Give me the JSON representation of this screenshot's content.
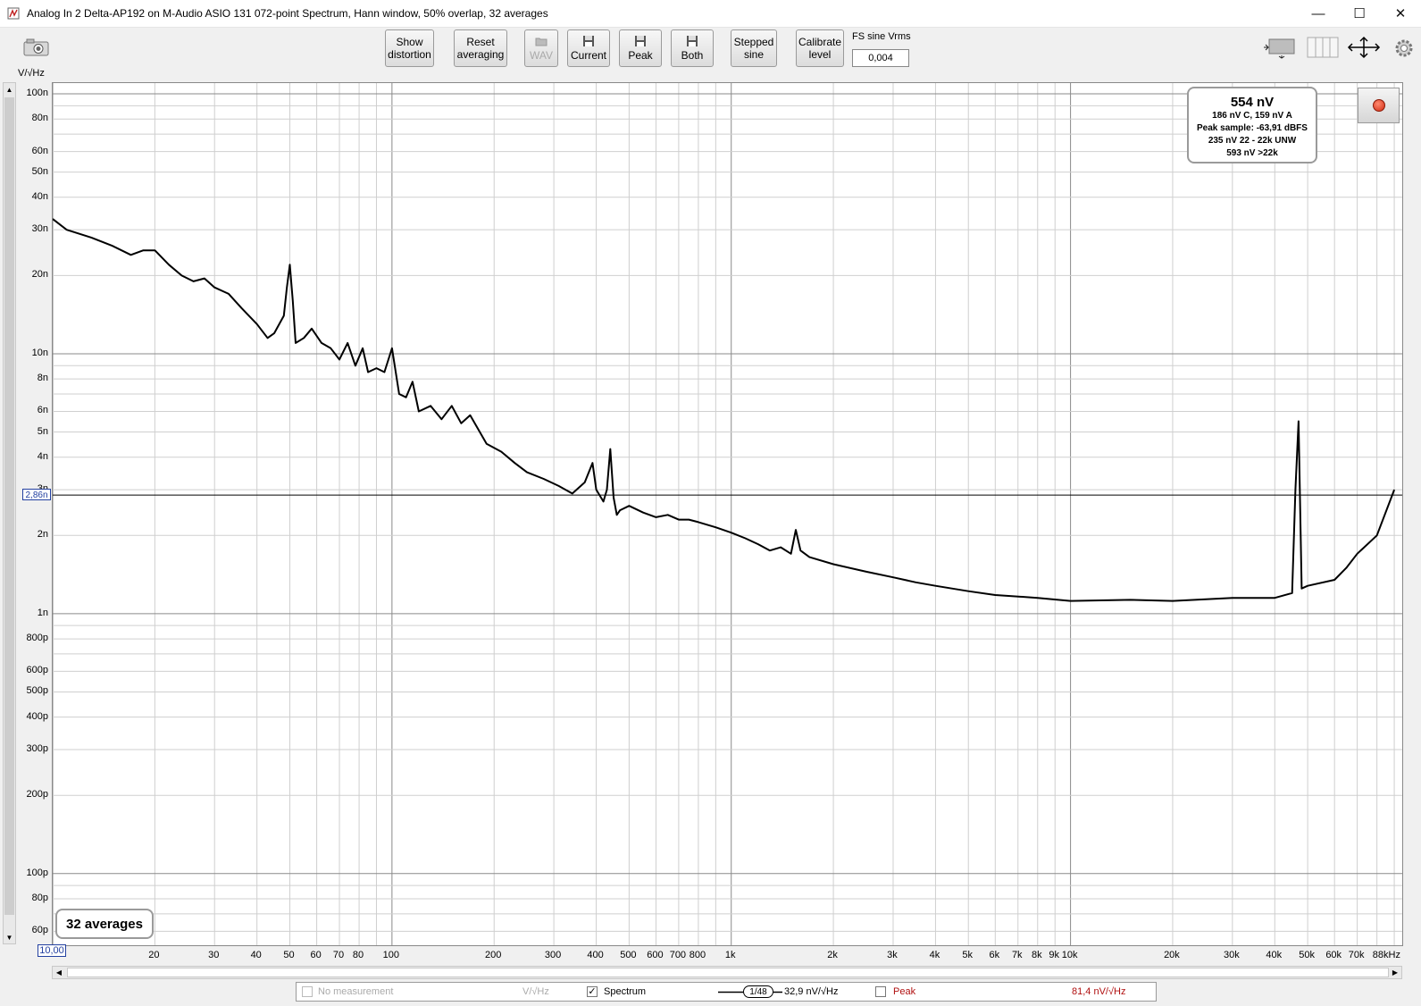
{
  "window": {
    "title": "Analog In 2 Delta-AP192 on M-Audio ASIO 131 072-point Spectrum, Hann window, 50% overlap, 32 averages",
    "minimize": "—",
    "maximize": "☐",
    "close": "✕"
  },
  "toolbar": {
    "show_distortion": [
      "Show",
      "distortion"
    ],
    "reset_averaging": [
      "Reset",
      "averaging"
    ],
    "wav": "WAV",
    "current": "Current",
    "peak": "Peak",
    "both": "Both",
    "stepped_sine": [
      "Stepped",
      "sine"
    ],
    "calibrate_level": [
      "Calibrate",
      "level"
    ],
    "fs_label": "FS sine Vrms",
    "fs_value": "0,004"
  },
  "plot": {
    "y_unit": "V/√Hz",
    "y_cursor": "2,86n",
    "x_cursor": "10,00",
    "averages_badge": "32 averages",
    "readout": {
      "main": "554 nV",
      "lines": [
        "186 nV C, 159 nV A",
        "Peak sample: -63,91 dBFS",
        "235 nV 22 - 22k UNW",
        "593 nV >22k"
      ]
    }
  },
  "legend": {
    "no_measurement": "No measurement",
    "no_measurement_unit": "V/√Hz",
    "spectrum": "Spectrum",
    "smoothing": "1/48",
    "spectrum_value": "32,9 nV/√Hz",
    "peak": "Peak",
    "peak_value": "81,4 nV/√Hz",
    "spectrum_checked": "✓",
    "peak_color": "#b01010"
  },
  "chart_data": {
    "type": "line",
    "title": "",
    "xlabel": "",
    "ylabel": "V/√Hz",
    "x_scale": "log",
    "y_scale": "log",
    "xlim": [
      10,
      95000
    ],
    "ylim": [
      5.3e-11,
      1.1e-07
    ],
    "grid": true,
    "x_tick_labels": [
      "20",
      "30",
      "40",
      "50",
      "60",
      "70",
      "80",
      "100",
      "200",
      "300",
      "400",
      "500",
      "600",
      "700",
      "800",
      "1k",
      "2k",
      "3k",
      "4k",
      "5k",
      "6k",
      "7k",
      "8k",
      "9k",
      "10k",
      "20k",
      "30k",
      "40k",
      "50k",
      "60k",
      "70k",
      "88kHz"
    ],
    "y_tick_labels": [
      "100n",
      "80n",
      "60n",
      "50n",
      "40n",
      "30n",
      "20n",
      "10n",
      "8n",
      "6n",
      "5n",
      "4n",
      "3n",
      "2n",
      "1n",
      "800p",
      "600p",
      "500p",
      "400p",
      "300p",
      "200p",
      "100p",
      "80p",
      "60p"
    ],
    "cursor_y": 2.86e-09,
    "series": [
      {
        "name": "Spectrum",
        "x": [
          10,
          11,
          13,
          15,
          17,
          18.5,
          20,
          22,
          24,
          26,
          28,
          30,
          33,
          36,
          40,
          43,
          45,
          48,
          49,
          50,
          51,
          52,
          55,
          58,
          62,
          66,
          70,
          74,
          78,
          82,
          85,
          90,
          95,
          100,
          105,
          110,
          115,
          120,
          130,
          140,
          150,
          160,
          170,
          190,
          210,
          230,
          250,
          280,
          310,
          340,
          370,
          390,
          400,
          420,
          430,
          440,
          450,
          460,
          470,
          500,
          550,
          600,
          650,
          700,
          750,
          800,
          900,
          1000,
          1100,
          1200,
          1300,
          1400,
          1500,
          1550,
          1600,
          1700,
          2000,
          2500,
          3000,
          3500,
          4000,
          5000,
          6000,
          8000,
          10000,
          15000,
          20000,
          30000,
          40000,
          45000,
          46000,
          47000,
          48000,
          50000,
          60000,
          65000,
          70000,
          80000,
          90000
        ],
        "y": [
          3.3e-08,
          3e-08,
          2.8e-08,
          2.6e-08,
          2.4e-08,
          2.5e-08,
          2.5e-08,
          2.2e-08,
          2e-08,
          1.9e-08,
          1.95e-08,
          1.8e-08,
          1.7e-08,
          1.5e-08,
          1.3e-08,
          1.15e-08,
          1.2e-08,
          1.4e-08,
          1.8e-08,
          2.2e-08,
          1.6e-08,
          1.1e-08,
          1.15e-08,
          1.25e-08,
          1.1e-08,
          1.05e-08,
          9.5e-09,
          1.1e-08,
          9e-09,
          1.05e-08,
          8.5e-09,
          8.8e-09,
          8.5e-09,
          1.05e-08,
          7e-09,
          6.8e-09,
          7.8e-09,
          6e-09,
          6.3e-09,
          5.6e-09,
          6.3e-09,
          5.4e-09,
          5.8e-09,
          4.5e-09,
          4.2e-09,
          3.8e-09,
          3.5e-09,
          3.3e-09,
          3.1e-09,
          2.9e-09,
          3.2e-09,
          3.8e-09,
          3e-09,
          2.7e-09,
          3e-09,
          4.3e-09,
          2.8e-09,
          2.4e-09,
          2.5e-09,
          2.6e-09,
          2.45e-09,
          2.35e-09,
          2.4e-09,
          2.3e-09,
          2.3e-09,
          2.25e-09,
          2.15e-09,
          2.05e-09,
          1.95e-09,
          1.85e-09,
          1.75e-09,
          1.8e-09,
          1.7e-09,
          2.1e-09,
          1.75e-09,
          1.65e-09,
          1.55e-09,
          1.45e-09,
          1.38e-09,
          1.32e-09,
          1.28e-09,
          1.22e-09,
          1.18e-09,
          1.15e-09,
          1.12e-09,
          1.13e-09,
          1.12e-09,
          1.15e-09,
          1.15e-09,
          1.2e-09,
          3e-09,
          5.5e-09,
          1.25e-09,
          1.28e-09,
          1.35e-09,
          1.5e-09,
          1.7e-09,
          2e-09,
          3e-09
        ]
      }
    ]
  }
}
